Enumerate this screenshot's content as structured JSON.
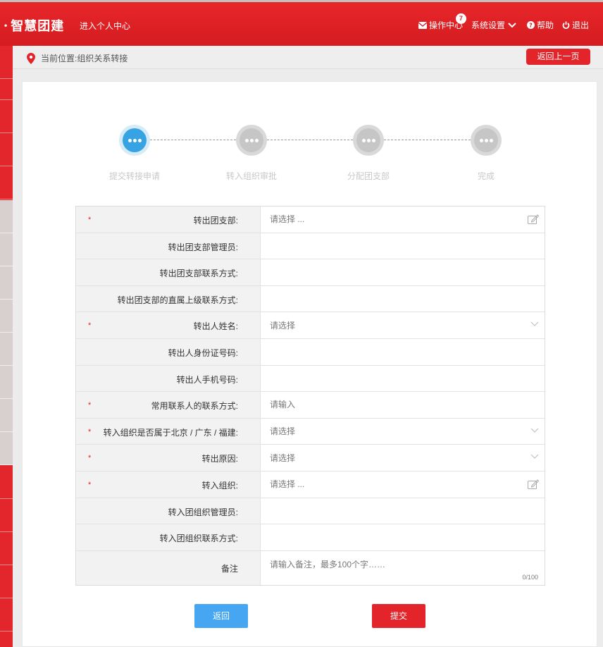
{
  "header": {
    "brand": "智慧团建",
    "personal_center": "进入个人中心",
    "nav": {
      "ops_center": "操作中心",
      "ops_badge": "7",
      "settings": "系统设置",
      "help": "帮助",
      "logout": "退出"
    }
  },
  "breadcrumb": {
    "text": "当前位置:组织关系转接",
    "back_button": "返回上一页"
  },
  "steps": [
    {
      "label": "提交转接申请",
      "state": "active"
    },
    {
      "label": "转入组织审批",
      "state": "pending"
    },
    {
      "label": "分配团支部",
      "state": "pending"
    },
    {
      "label": "完成",
      "state": "pending"
    }
  ],
  "form": {
    "required_mark": "*",
    "rows": [
      {
        "label": "转出团支部:",
        "placeholder": "请选择 ...",
        "value": ""
      },
      {
        "label": "转出团支部管理员:",
        "placeholder": "",
        "value": ""
      },
      {
        "label": "转出团支部联系方式:",
        "placeholder": "",
        "value": ""
      },
      {
        "label": "转出团支部的直属上级联系方式:",
        "placeholder": "",
        "value": ""
      },
      {
        "label": "转出人姓名:",
        "placeholder": "请选择",
        "value": ""
      },
      {
        "label": "转出人身份证号码:",
        "placeholder": "",
        "value": ""
      },
      {
        "label": "转出人手机号码:",
        "placeholder": "",
        "value": ""
      },
      {
        "label": "常用联系人的联系方式:",
        "placeholder": "请输入",
        "value": ""
      },
      {
        "label": "转入组织是否属于北京 / 广东 / 福建:",
        "placeholder": "请选择",
        "value": ""
      },
      {
        "label": "转出原因:",
        "placeholder": "请选择",
        "value": ""
      },
      {
        "label": "转入组织:",
        "placeholder": "请选择 ...",
        "value": ""
      },
      {
        "label": "转入团组织管理员:",
        "placeholder": "",
        "value": ""
      },
      {
        "label": "转入团组织联系方式:",
        "placeholder": "",
        "value": ""
      },
      {
        "label": "备注",
        "placeholder": "请输入备注，最多100个字……",
        "value": "",
        "counter": "0/100"
      }
    ]
  },
  "buttons": {
    "back": "返回",
    "submit": "提交"
  },
  "colors": {
    "primary_red": "#e3242a",
    "active_blue": "#38a3e3",
    "button_blue": "#46a6f2"
  }
}
